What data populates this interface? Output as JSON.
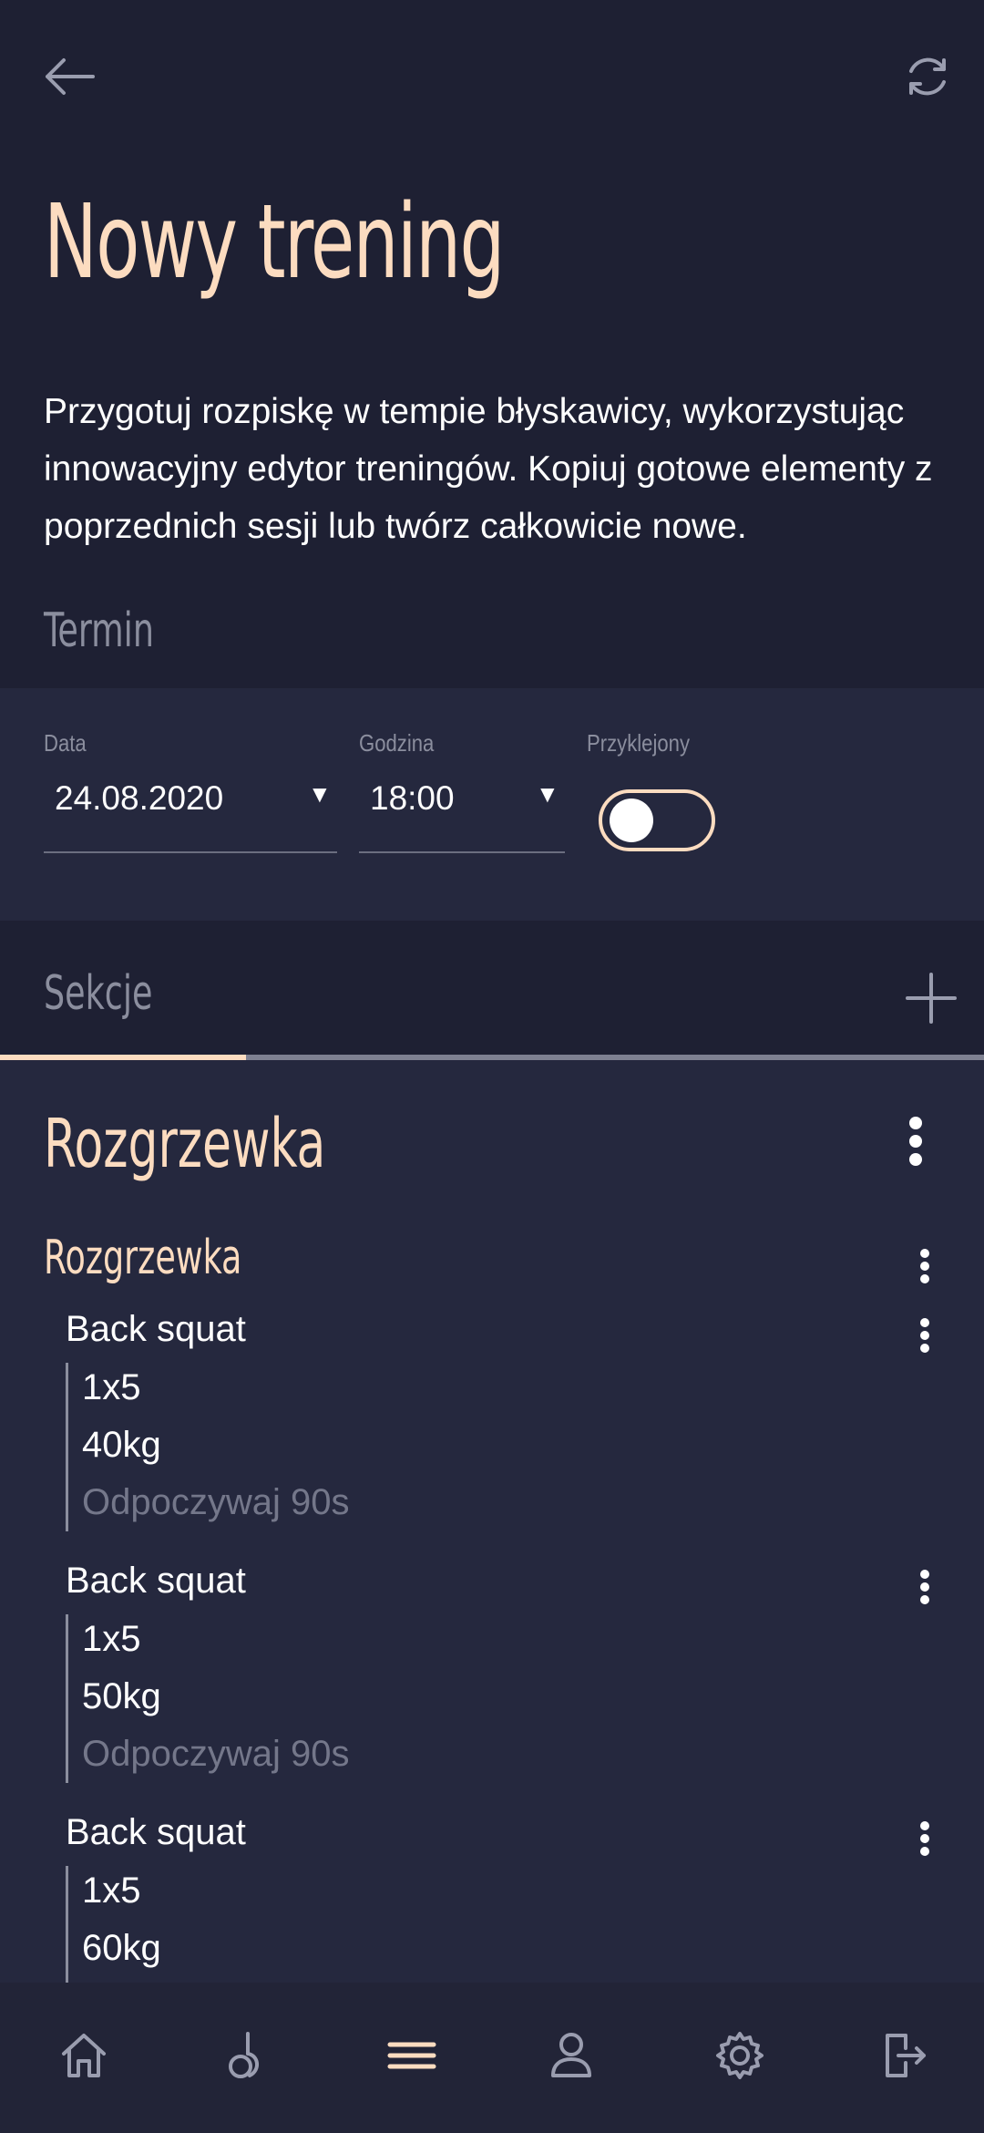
{
  "header": {
    "title": "Nowy trening",
    "description": "Przygotuj rozpiskę w tempie błyskawicy, wykorzystując innowacyjny edytor treningów. Kopiuj gotowe elementy z poprzednich sesji lub twórz całkowicie nowe.",
    "back_icon": "arrow-left-icon",
    "refresh_icon": "refresh-icon"
  },
  "termin": {
    "label": "Termin",
    "date_label": "Data",
    "date_value": "24.08.2020",
    "time_label": "Godzina",
    "time_value": "18:00",
    "pinned_label": "Przyklejony",
    "pinned_on": false
  },
  "sections": {
    "label": "Sekcje",
    "add_icon": "plus-icon"
  },
  "section": {
    "title": "Rozgrzewka",
    "group_title": "Rozgrzewka",
    "exercises": [
      {
        "name": "Back squat",
        "sets": "1x5",
        "weight": "40kg",
        "rest": "Odpoczywaj 90s"
      },
      {
        "name": "Back squat",
        "sets": "1x5",
        "weight": "50kg",
        "rest": "Odpoczywaj 90s"
      },
      {
        "name": "Back squat",
        "sets": "1x5",
        "weight": "60kg"
      }
    ]
  },
  "nav": {
    "items": [
      "home-icon",
      "kettlebell-icon",
      "menu-icon",
      "profile-icon",
      "settings-icon",
      "logout-icon"
    ],
    "active": "menu-icon"
  },
  "colors": {
    "background": "#1e2033",
    "panel": "#25283e",
    "accent": "#fcdcc0",
    "muted": "#8b8e9e"
  }
}
